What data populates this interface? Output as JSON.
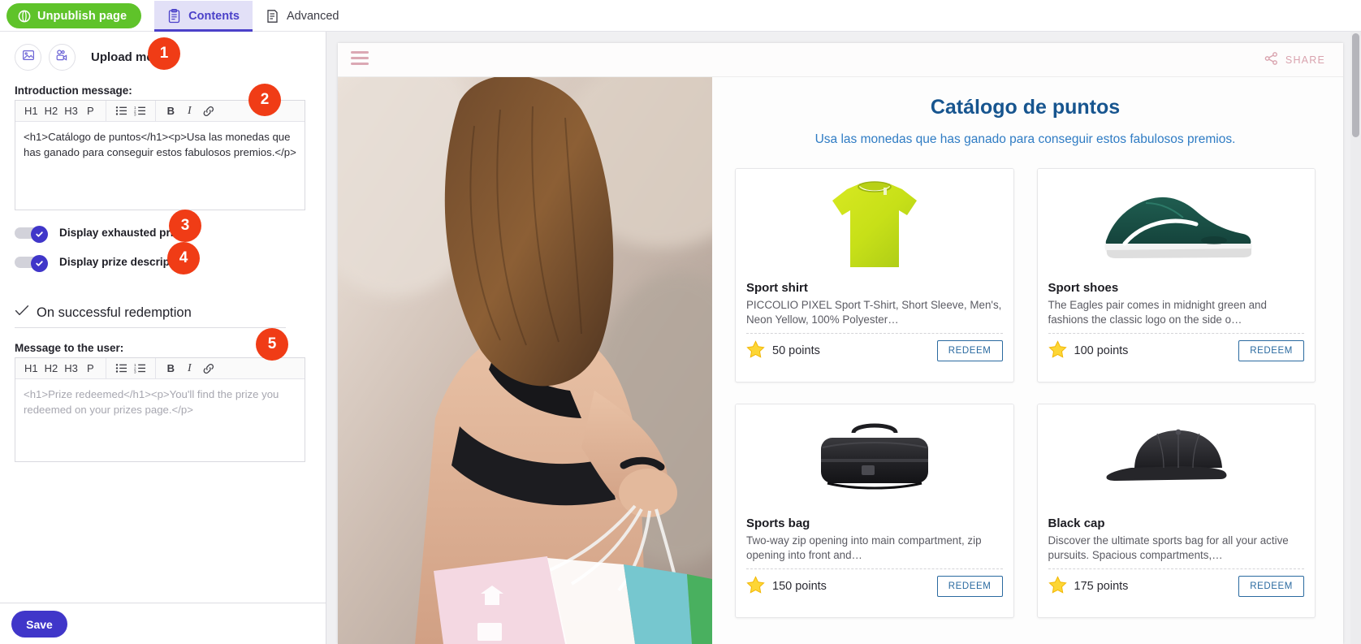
{
  "topbar": {
    "unpublish_label": "Unpublish page",
    "unpublish_color": "#5fc32a",
    "tabs": [
      {
        "label": "Contents",
        "icon": "clipboard-icon",
        "active": true
      },
      {
        "label": "Advanced",
        "icon": "document-icon",
        "active": false
      }
    ],
    "active_tab_color": "#4b41c9"
  },
  "left_panel": {
    "upload_media_label": "Upload media",
    "upload_image_icon": "image-icon",
    "upload_video_icon": "video-camera-icon",
    "intro_label": "Introduction message:",
    "intro_value": "<h1>Catálogo de puntos</h1><p>Usa las monedas que has ganado para conseguir estos fabulosos premios.</p>",
    "toolbar": {
      "h1": "H1",
      "h2": "H2",
      "h3": "H3",
      "p": "P",
      "bullet_list": "bullet-list-icon",
      "numbered_list": "numbered-list-icon",
      "bold": "B",
      "italic": "I",
      "link": "link-icon"
    },
    "toggles": [
      {
        "label": "Display exhausted prizes",
        "checked": true
      },
      {
        "label": "Display prize description",
        "checked": true
      }
    ],
    "section_title": "On successful redemption",
    "section_icon": "check-icon",
    "message_label": "Message to the user:",
    "message_placeholder": "<h1>Prize redeemed</h1><p>You'll find the prize you redeemed on your prizes page.</p>",
    "save_label": "Save",
    "save_color": "#4036c9"
  },
  "badges": [
    {
      "number": "1"
    },
    {
      "number": "2"
    },
    {
      "number": "3"
    },
    {
      "number": "4"
    },
    {
      "number": "5"
    }
  ],
  "badge_color": "#f03c16",
  "preview": {
    "menu_icon": "hamburger-menu-icon",
    "share_label": "SHARE",
    "share_icon": "share-nodes-icon",
    "hero_alt": "woman-with-shopping-bags-photo",
    "catalog_title": "Catálogo de puntos",
    "catalog_subtitle": "Usa las monedas que has ganado para conseguir estos fabulosos premios.",
    "title_color": "#17558f",
    "subtitle_color": "#2f7cc4",
    "points_icon": "star-icon",
    "cards": [
      {
        "name": "Sport shirt",
        "description": "PICCOLIO PIXEL Sport T-Shirt, Short Sleeve, Men's, Neon Yellow, 100% Polyester…",
        "points": "50 points",
        "redeem_label": "REDEEM",
        "image": "yellow-tshirt-image"
      },
      {
        "name": "Sport shoes",
        "description": "The Eagles pair comes in midnight green and fashions the classic logo on the side o…",
        "points": "100 points",
        "redeem_label": "REDEEM",
        "image": "green-sneaker-image"
      },
      {
        "name": "Sports bag",
        "description": "Two-way zip opening into main compartment, zip opening into front and…",
        "points": "150 points",
        "redeem_label": "REDEEM",
        "image": "black-duffel-bag-image"
      },
      {
        "name": "Black cap",
        "description": "Discover the ultimate sports bag for all your active pursuits. Spacious compartments,…",
        "points": "175 points",
        "redeem_label": "REDEEM",
        "image": "black-cap-image"
      }
    ]
  }
}
